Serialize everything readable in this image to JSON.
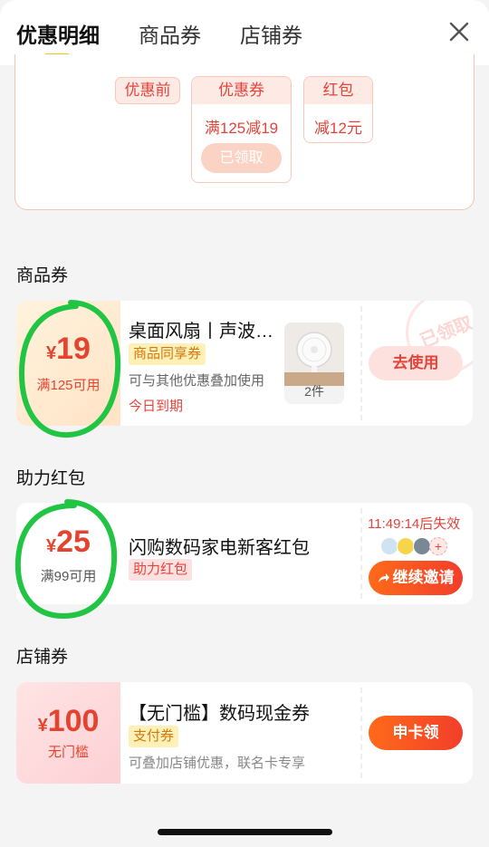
{
  "header": {
    "tabs": [
      {
        "label": "优惠明细",
        "active": true
      },
      {
        "label": "商品券",
        "active": false
      },
      {
        "label": "店铺券",
        "active": false
      }
    ],
    "close_icon": "close-icon"
  },
  "summary": {
    "before_label": "优惠前",
    "coupon_chip": {
      "label": "优惠券",
      "value": "满125减19",
      "claimed_button": "已领取"
    },
    "redpacket_chip": {
      "label": "红包",
      "value": "减12元"
    }
  },
  "product_coupon_section": {
    "title": "商品券",
    "coupon": {
      "currency": "¥",
      "amount": "19",
      "condition": "满125可用",
      "title": "桌面风扇丨声波…",
      "tag": "商品同享券",
      "description": "可与其他优惠叠加使用",
      "expiry": "今日到期",
      "item_count": "2件",
      "button": "去使用",
      "stamp": "已领取"
    }
  },
  "redpacket_section": {
    "title": "助力红包",
    "coupon": {
      "currency": "¥",
      "amount": "25",
      "condition": "满99可用",
      "title": "闪购数码家电新客红包",
      "tag": "助力红包",
      "countdown": "11:49:14后失效",
      "button": "继续邀请",
      "add_label": "+"
    }
  },
  "shop_coupon_section": {
    "title": "店铺券",
    "coupon": {
      "currency": "¥",
      "amount": "100",
      "condition": "无门槛",
      "title": "【无门槛】数码现金券",
      "tag": "支付券",
      "description": "可叠加店铺优惠，联名卡专享",
      "button": "申卡领"
    }
  },
  "colors": {
    "accent_red": "#e4432f",
    "tab_indicator": "#f5c518",
    "tag_yellow_bg": "#fdf1b8",
    "button_gradient_start": "#ff6a1a",
    "button_gradient_end": "#f23e2b",
    "highlight_circle": "#22c443"
  }
}
